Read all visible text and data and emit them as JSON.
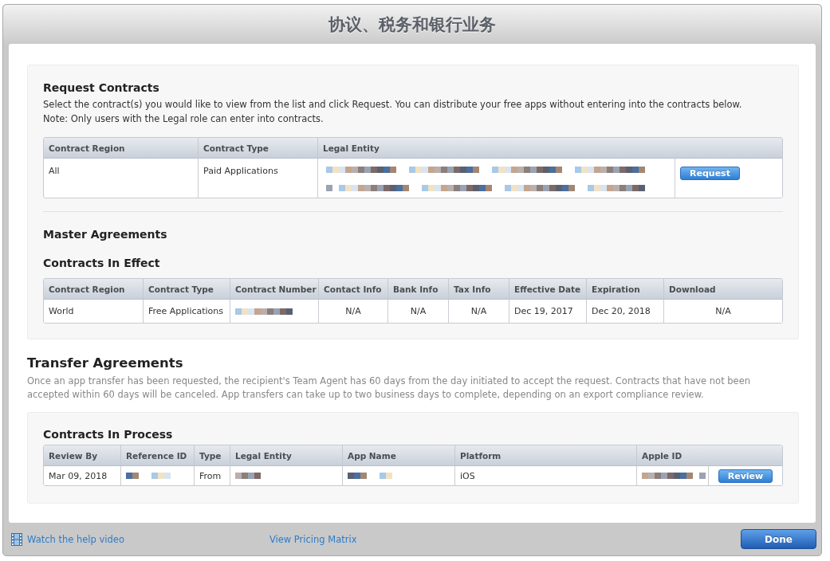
{
  "window": {
    "title": "协议、税务和银行业务"
  },
  "request_contracts": {
    "heading": "Request Contracts",
    "description": [
      "Select the contract(s) you would like to view from the list and click Request. You can distribute your free apps without entering into the contracts below.",
      "Note: Only users with the Legal role can enter into contracts."
    ],
    "table": {
      "columns": [
        {
          "label": "Contract Region"
        },
        {
          "label": "Contract Type"
        },
        {
          "label": "Legal Entity",
          "colspan": 2
        }
      ],
      "rows": [
        {
          "cells": [
            {
              "kind": "text",
              "text": "All"
            },
            {
              "kind": "text",
              "text": "Paid Applications"
            },
            {
              "kind": "pixelated"
            },
            {
              "kind": "button",
              "label": "Request"
            }
          ]
        }
      ]
    }
  },
  "master_agreements": {
    "heading": "Master Agreements",
    "subheading": "Contracts In Effect",
    "table": {
      "columns": [
        {
          "label": "Contract Region"
        },
        {
          "label": "Contract Type"
        },
        {
          "label": "Contract Number"
        },
        {
          "label": "Contact Info"
        },
        {
          "label": "Bank Info"
        },
        {
          "label": "Tax Info"
        },
        {
          "label": "Effective Date"
        },
        {
          "label": "Expiration"
        },
        {
          "label": "Download"
        }
      ],
      "rows": [
        {
          "cells": [
            {
              "kind": "text",
              "text": "World"
            },
            {
              "kind": "text",
              "text": "Free Applications"
            },
            {
              "kind": "pixelated"
            },
            {
              "kind": "text",
              "text": "N/A"
            },
            {
              "kind": "text",
              "text": "N/A"
            },
            {
              "kind": "text",
              "text": "N/A"
            },
            {
              "kind": "text",
              "text": "Dec 19, 2017"
            },
            {
              "kind": "text",
              "text": "Dec 20, 2018"
            },
            {
              "kind": "text",
              "text": "N/A"
            }
          ]
        }
      ]
    }
  },
  "transfer_agreements": {
    "heading": "Transfer Agreements",
    "description": "Once an app transfer has been requested, the recipient's Team Agent has 60 days from the day initiated to accept the request. Contracts that have not been accepted within 60 days will be canceled. App transfers can take up to two business days to complete, depending on an export compliance review.",
    "subheading": "Contracts In Process",
    "table": {
      "columns": [
        {
          "label": "Review By"
        },
        {
          "label": "Reference ID"
        },
        {
          "label": "Type"
        },
        {
          "label": "Legal Entity"
        },
        {
          "label": "App Name"
        },
        {
          "label": "Platform"
        },
        {
          "label": "Apple ID",
          "colspan": 2
        }
      ],
      "rows": [
        {
          "cells": [
            {
              "kind": "text",
              "text": "Mar 09, 2018"
            },
            {
              "kind": "pixelated"
            },
            {
              "kind": "text",
              "text": "From"
            },
            {
              "kind": "pixelated"
            },
            {
              "kind": "pixelated"
            },
            {
              "kind": "text",
              "text": "iOS"
            },
            {
              "kind": "pixelated"
            },
            {
              "kind": "button",
              "label": "Review"
            }
          ]
        }
      ]
    }
  },
  "footer": {
    "help_link": "Watch the help video",
    "pricing_link": "View Pricing Matrix",
    "done_button": "Done"
  }
}
